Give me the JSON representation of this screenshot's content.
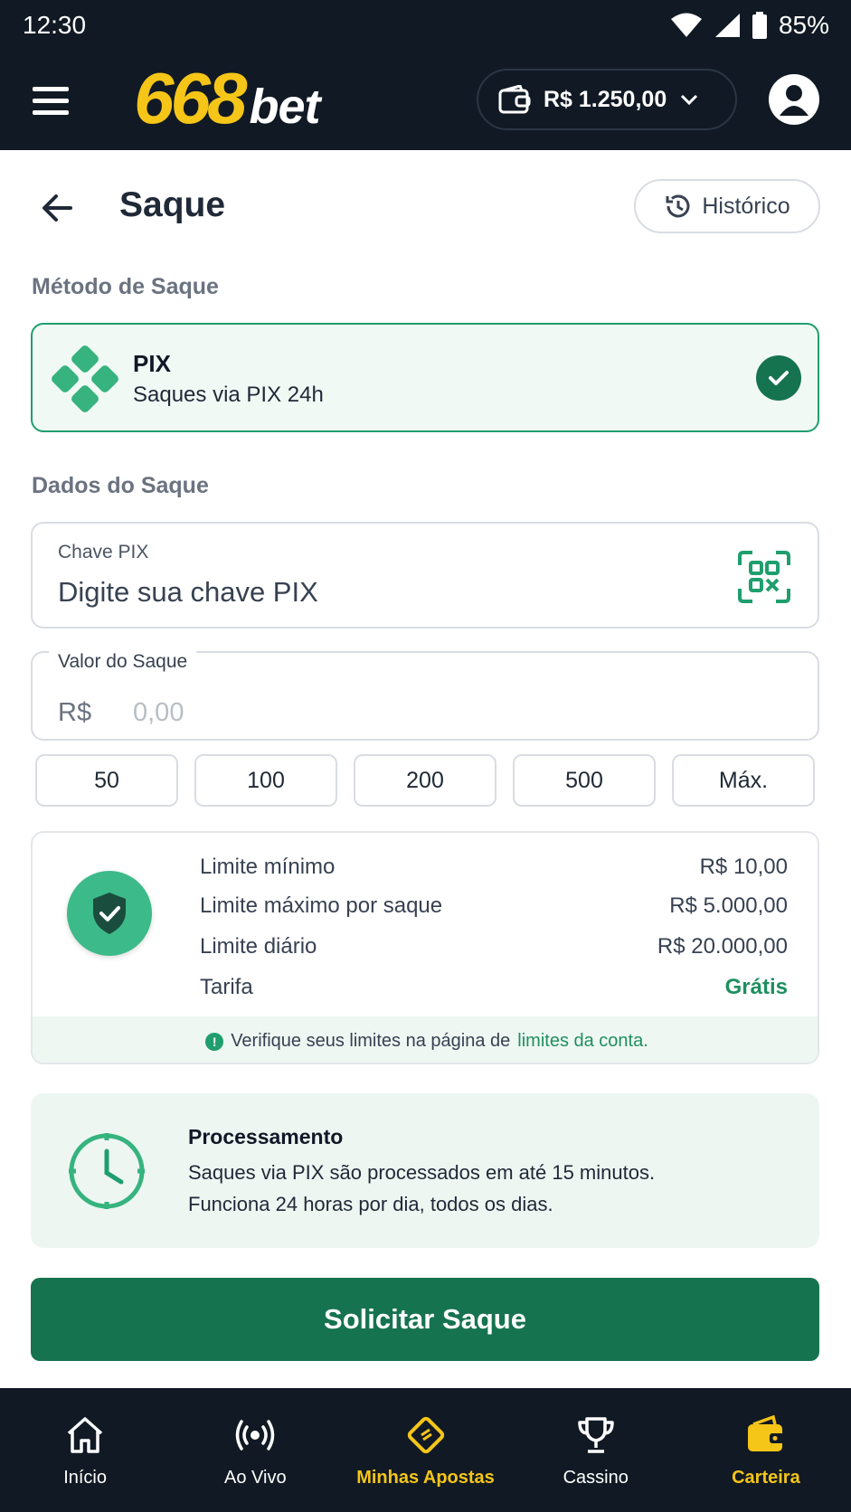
{
  "status_bar": {
    "time": "12:30",
    "battery": "85%"
  },
  "header": {
    "logo_number": "668",
    "logo_word": "bet",
    "balance": "R$ 1.250,00"
  },
  "page": {
    "title": "Saque",
    "history_label": "Histórico"
  },
  "method_section": {
    "label": "Método de Saque",
    "method_name": "PIX",
    "method_desc": "Saques via PIX 24h"
  },
  "data_section": {
    "label": "Dados do Saque",
    "pix_key_label": "Chave PIX",
    "pix_key_placeholder": "Digite sua chave PIX",
    "amount_label": "Valor do Saque",
    "currency": "R$",
    "amount_placeholder": "0,00",
    "quick_amounts": [
      "50",
      "100",
      "200",
      "500",
      "Máx."
    ]
  },
  "limits": {
    "rows": [
      {
        "label": "Limite mínimo",
        "value": "R$ 10,00"
      },
      {
        "label": "Limite máximo por saque",
        "value": "R$ 5.000,00"
      },
      {
        "label": "Limite diário",
        "value": "R$ 20.000,00"
      },
      {
        "label": "Tarifa",
        "value": "Grátis"
      }
    ],
    "note_prefix": "Verifique seus limites na página de",
    "note_link": "limites da conta."
  },
  "processing": {
    "title": "Processamento",
    "line1": "Saques via PIX são processados em até 15 minutos.",
    "line2": "Funciona 24 horas por dia, todos os dias."
  },
  "submit_label": "Solicitar Saque",
  "bottom_nav": [
    {
      "label": "Início",
      "icon": "home-icon"
    },
    {
      "label": "Ao Vivo",
      "icon": "live-icon"
    },
    {
      "label": "Minhas Apostas",
      "icon": "ticket-icon"
    },
    {
      "label": "Cassino",
      "icon": "trophy-icon"
    },
    {
      "label": "Carteira",
      "icon": "wallet-icon"
    }
  ],
  "colors": {
    "brand_yellow": "#f5c518",
    "brand_green": "#16734f",
    "header_bg": "#111a24"
  }
}
